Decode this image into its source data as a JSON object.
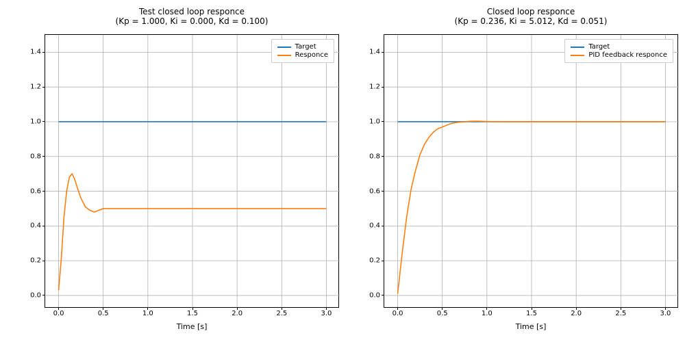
{
  "chart_data": [
    {
      "type": "line",
      "title_line1": "Test closed loop responce",
      "title_line2": "(Kp = 1.000, Ki = 0.000, Kd = 0.100)",
      "xlabel": "Time [s]",
      "ylabel": "",
      "xlim": [
        -0.15,
        3.15
      ],
      "ylim": [
        -0.075,
        1.5
      ],
      "xticks": [
        0.0,
        0.5,
        1.0,
        1.5,
        2.0,
        2.5,
        3.0
      ],
      "yticks": [
        0.0,
        0.2,
        0.4,
        0.6,
        0.8,
        1.0,
        1.2,
        1.4
      ],
      "series": [
        {
          "name": "Target",
          "color": "#1f77b4",
          "x": [
            0.0,
            0.1,
            0.2,
            0.3,
            0.4,
            0.5,
            0.6,
            0.7,
            0.8,
            0.9,
            1.0,
            1.1,
            1.2,
            1.3,
            1.4,
            1.5,
            1.6,
            1.7,
            1.8,
            1.9,
            2.0,
            2.1,
            2.2,
            2.3,
            2.4,
            2.5,
            2.6,
            2.7,
            2.8,
            2.9,
            3.0
          ],
          "y": [
            1,
            1,
            1,
            1,
            1,
            1,
            1,
            1,
            1,
            1,
            1,
            1,
            1,
            1,
            1,
            1,
            1,
            1,
            1,
            1,
            1,
            1,
            1,
            1,
            1,
            1,
            1,
            1,
            1,
            1,
            1
          ]
        },
        {
          "name": "Responce",
          "color": "#ff7f0e",
          "x": [
            0.0,
            0.03,
            0.06,
            0.09,
            0.12,
            0.15,
            0.18,
            0.21,
            0.25,
            0.3,
            0.35,
            0.4,
            0.45,
            0.5,
            0.55,
            0.6,
            0.7,
            0.8,
            0.9,
            1.0,
            1.2,
            1.5,
            2.0,
            2.5,
            3.0
          ],
          "y": [
            0.03,
            0.21,
            0.45,
            0.6,
            0.68,
            0.7,
            0.67,
            0.62,
            0.56,
            0.51,
            0.49,
            0.48,
            0.49,
            0.5,
            0.5,
            0.5,
            0.5,
            0.5,
            0.5,
            0.5,
            0.5,
            0.5,
            0.5,
            0.5,
            0.5
          ]
        }
      ]
    },
    {
      "type": "line",
      "title_line1": "Closed loop responce",
      "title_line2": "(Kp = 0.236, Ki = 5.012, Kd = 0.051)",
      "xlabel": "Time [s]",
      "ylabel": "",
      "xlim": [
        -0.15,
        3.15
      ],
      "ylim": [
        -0.075,
        1.5
      ],
      "xticks": [
        0.0,
        0.5,
        1.0,
        1.5,
        2.0,
        2.5,
        3.0
      ],
      "yticks": [
        0.0,
        0.2,
        0.4,
        0.6,
        0.8,
        1.0,
        1.2,
        1.4
      ],
      "series": [
        {
          "name": "Target",
          "color": "#1f77b4",
          "x": [
            0.0,
            0.1,
            0.2,
            0.3,
            0.4,
            0.5,
            0.6,
            0.7,
            0.8,
            0.9,
            1.0,
            1.1,
            1.2,
            1.3,
            1.4,
            1.5,
            1.6,
            1.7,
            1.8,
            1.9,
            2.0,
            2.1,
            2.2,
            2.3,
            2.4,
            2.5,
            2.6,
            2.7,
            2.8,
            2.9,
            3.0
          ],
          "y": [
            1,
            1,
            1,
            1,
            1,
            1,
            1,
            1,
            1,
            1,
            1,
            1,
            1,
            1,
            1,
            1,
            1,
            1,
            1,
            1,
            1,
            1,
            1,
            1,
            1,
            1,
            1,
            1,
            1,
            1,
            1
          ]
        },
        {
          "name": "PID feedback responce",
          "color": "#ff7f0e",
          "x": [
            0.0,
            0.05,
            0.1,
            0.15,
            0.2,
            0.25,
            0.3,
            0.35,
            0.4,
            0.45,
            0.5,
            0.55,
            0.6,
            0.65,
            0.7,
            0.75,
            0.8,
            0.85,
            0.9,
            0.95,
            1.0,
            1.1,
            1.2,
            1.4,
            1.6,
            1.8,
            2.0,
            2.5,
            3.0
          ],
          "y": [
            0.01,
            0.24,
            0.45,
            0.61,
            0.72,
            0.81,
            0.87,
            0.91,
            0.94,
            0.96,
            0.97,
            0.98,
            0.99,
            0.995,
            0.998,
            0.999,
            1.002,
            1.003,
            1.003,
            1.002,
            1.001,
            1.0,
            1.0,
            1.0,
            1.0,
            1.0,
            1.0,
            1.0,
            1.0
          ]
        }
      ]
    }
  ]
}
